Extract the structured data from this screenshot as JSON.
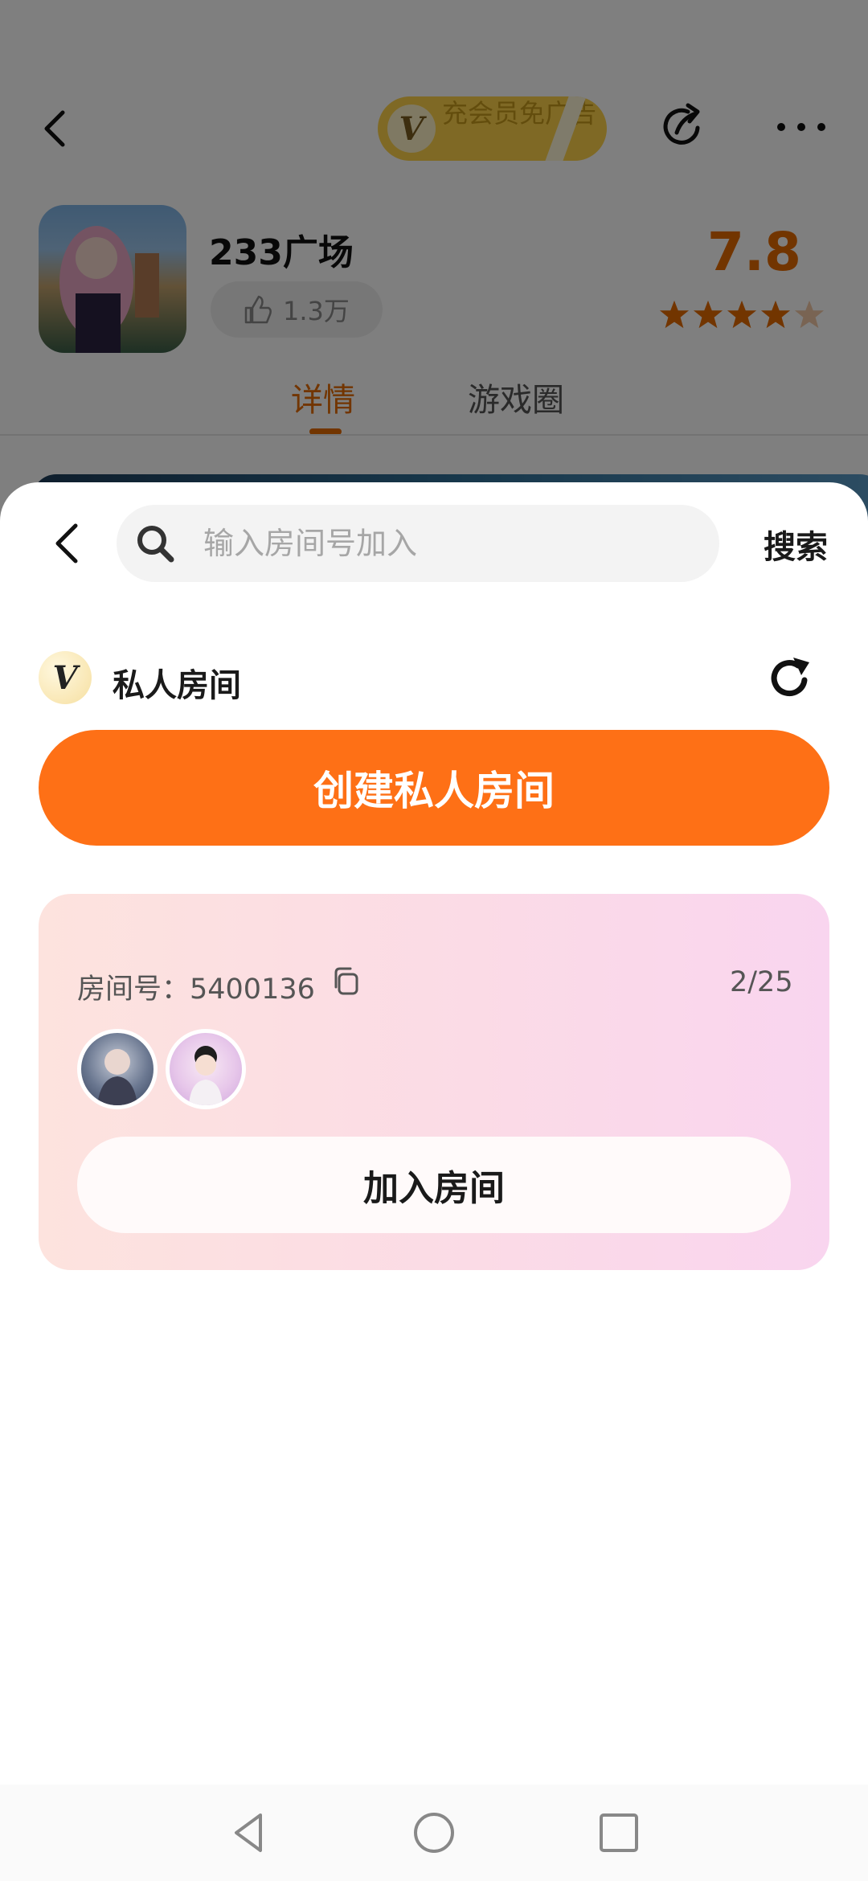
{
  "background_page": {
    "vip_banner_text": "充会员免广告",
    "vip_badge_letter": "V",
    "app_name": "233广场",
    "likes": "1.3万",
    "score": "7.8",
    "star_rating": 4.5,
    "tabs": [
      {
        "label": "详情",
        "active": true
      },
      {
        "label": "游戏圈",
        "active": false
      }
    ]
  },
  "sheet": {
    "search": {
      "placeholder": "输入房间号加入",
      "value": "",
      "button_label": "搜索"
    },
    "section": {
      "badge_letter": "V",
      "title": "私人房间"
    },
    "create_button_label": "创建私人房间",
    "room": {
      "id_label": "房间号：5400136",
      "count": "2/25",
      "join_button_label": "加入房间"
    }
  },
  "colors": {
    "accent_orange": "#fe7016",
    "score_orange": "#e46a00",
    "vip_yellow": "#ffd24a"
  },
  "icons": [
    "back-arrow-icon",
    "share-icon",
    "more-icon",
    "thumbs-up-icon",
    "star-icon",
    "search-icon",
    "refresh-icon",
    "copy-icon",
    "nav-back-icon",
    "nav-home-icon",
    "nav-recent-icon"
  ]
}
